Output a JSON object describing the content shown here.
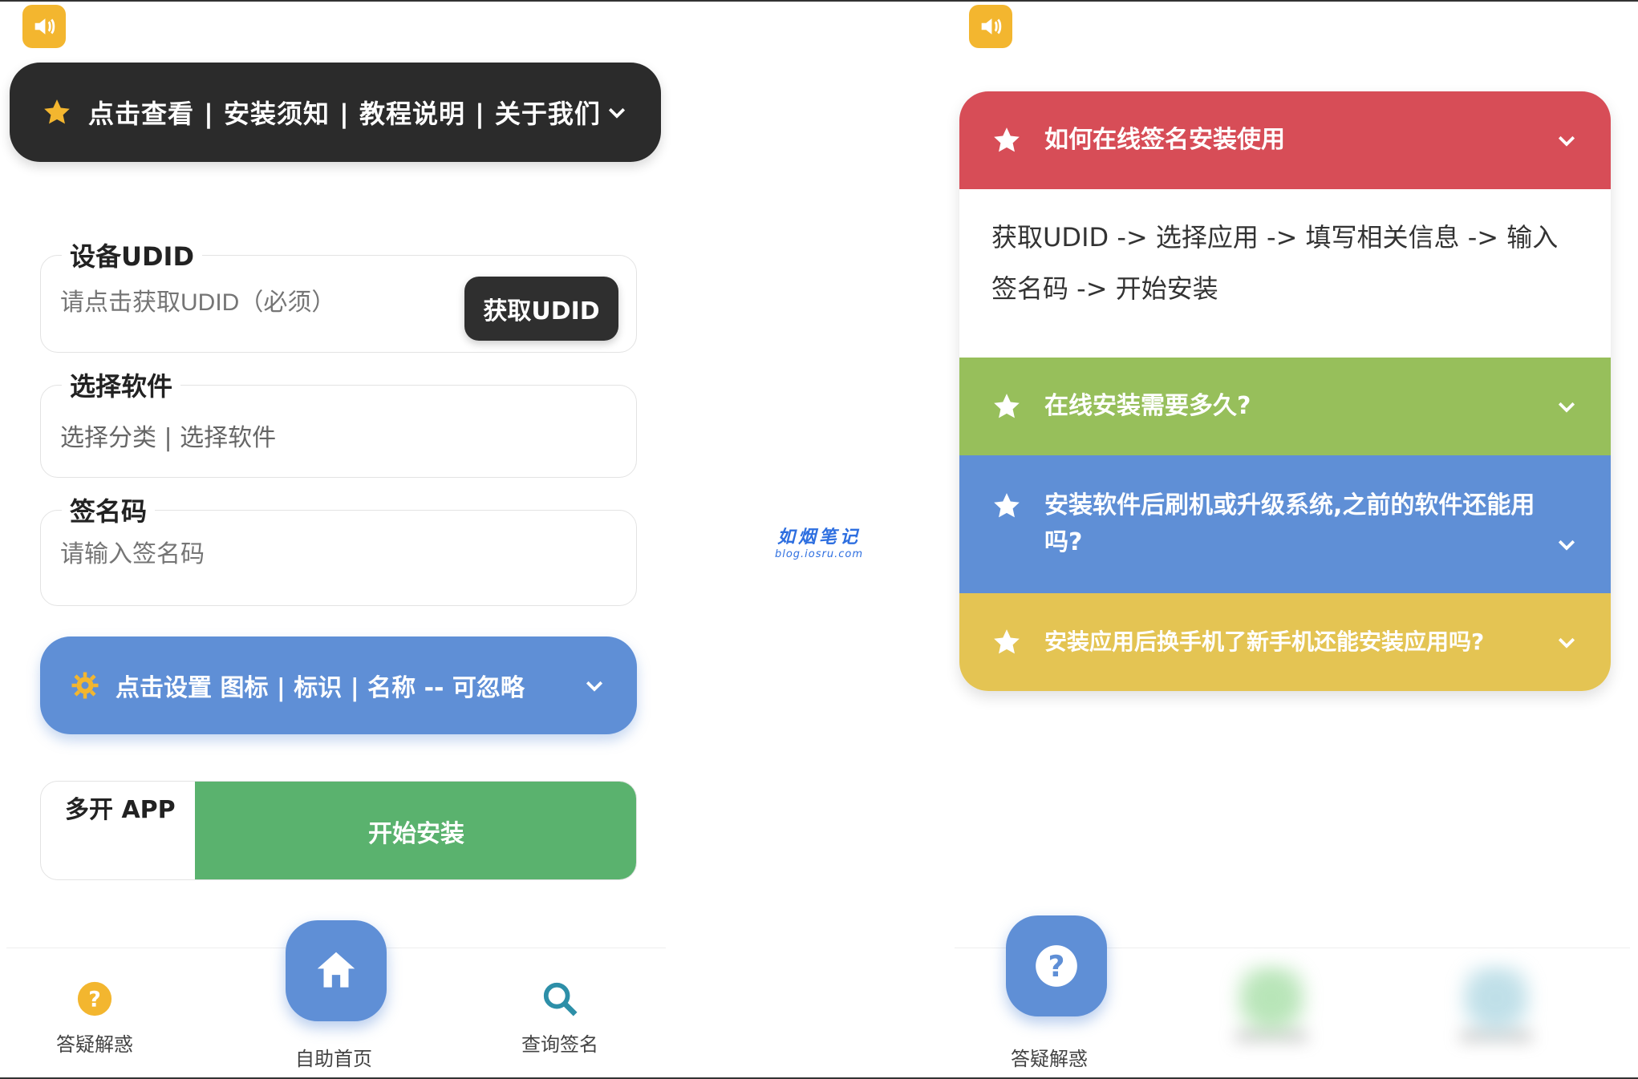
{
  "left": {
    "notice": {
      "text": "点击查看 | 安装须知 | 教程说明 | 关于我们"
    },
    "udid_field": {
      "label": "设备UDID",
      "placeholder": "请点击获取UDID（必须）",
      "button": "获取UDID"
    },
    "software_field": {
      "label": "选择软件",
      "value": "选择分类 | 选择软件"
    },
    "sign_field": {
      "label": "签名码",
      "placeholder": "请输入签名码"
    },
    "settings_bar": {
      "text": "点击设置 图标 | 标识 | 名称 -- 可忽略"
    },
    "multi": {
      "label": "多开 APP",
      "install_button": "开始安装"
    },
    "nav": {
      "help": "答疑解惑",
      "home": "自助首页",
      "query": "查询签名"
    }
  },
  "right": {
    "faq": [
      {
        "question": "如何在线签名安装使用",
        "answer": "获取UDID -> 选择应用 -> 填写相关信息 -> 输入签名码 -> 开始安装",
        "color": "#d74d57"
      },
      {
        "question": "在线安装需要多久?",
        "color": "#97bf5b"
      },
      {
        "question": "安装软件后刷机或升级系统,之前的软件还能用吗?",
        "color": "#5f8fd6"
      },
      {
        "question": "安装应用后换手机了新手机还能安装应用吗?",
        "color": "#e4c453"
      }
    ],
    "nav": {
      "help": "答疑解惑"
    }
  },
  "watermark": {
    "line1": "如烟笔记",
    "line2": "blog.iosru.com"
  },
  "colors": {
    "accent_blue": "#5f8fd6",
    "dark": "#2b2b2b",
    "install_green": "#5ab26e",
    "icon_yellow": "#f3b62f"
  }
}
